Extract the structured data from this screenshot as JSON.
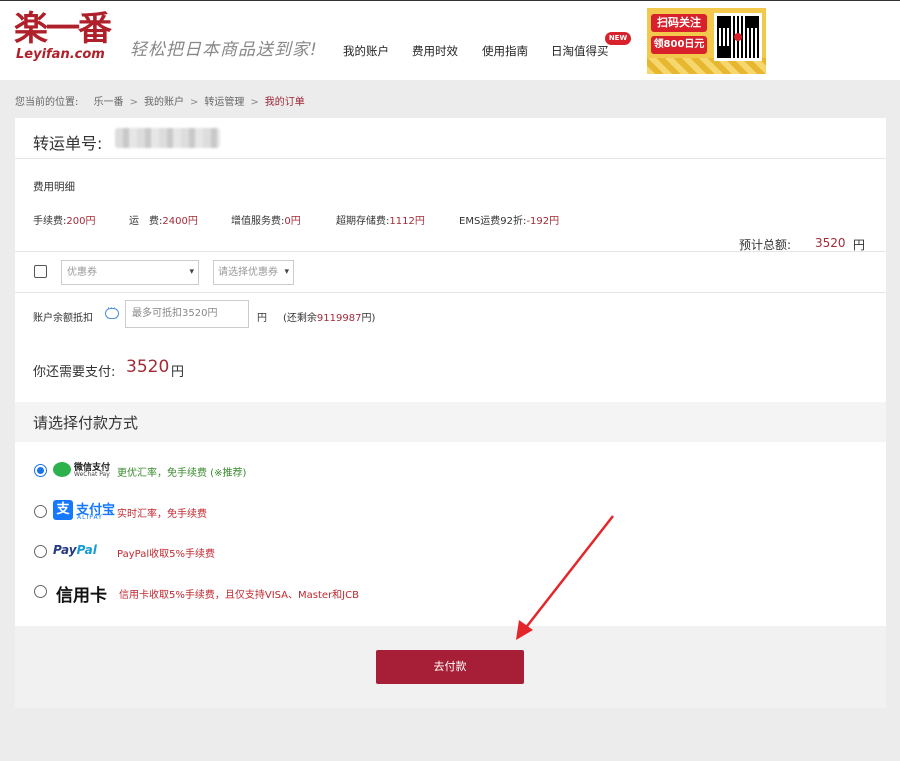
{
  "header": {
    "logo_cn": "楽一番",
    "logo_en": "Leyifan.com",
    "slogan": "轻松把日本商品送到家!",
    "nav": [
      "我的账户",
      "费用时效",
      "使用指南",
      "日淘值得买"
    ],
    "new_badge": "NEW",
    "promo_line1": "扫码关注",
    "promo_line2": "领800日元"
  },
  "breadcrumb": {
    "prefix": "您当前的位置:",
    "items": [
      "乐一番",
      "我的账户",
      "转运管理"
    ],
    "current": "我的订单"
  },
  "order": {
    "title": "转运单号:"
  },
  "fees": {
    "title": "费用明细",
    "items": [
      {
        "label": "手续费:",
        "value": "200",
        "unit": "円"
      },
      {
        "label": "运　费:",
        "value": "2400",
        "unit": "円"
      },
      {
        "label": "增值服务费:",
        "value": "0",
        "unit": "円"
      },
      {
        "label": "超期存储费:",
        "value": "1112",
        "unit": "円"
      },
      {
        "label": "EMS运费92折:",
        "value": "-192",
        "unit": "円"
      }
    ],
    "total_label": "预计总额:",
    "total_value": "3520",
    "total_unit": "円"
  },
  "coupon": {
    "select1_placeholder": "优惠券",
    "select2_placeholder": "请选择优惠券"
  },
  "balance": {
    "label": "账户余额抵扣",
    "input_placeholder": "最多可抵扣3520円",
    "unit": "円",
    "remain_prefix": "(还剩余",
    "remain_value": "9119987",
    "remain_suffix": "円)"
  },
  "payable": {
    "label": "你还需要支付:",
    "amount": "3520",
    "unit": "円"
  },
  "methods": {
    "title": "请选择付款方式",
    "wechat": {
      "name_cn": "微信支付",
      "name_en": "WeChat Pay",
      "note": "更优汇率，免手续费 (※推荐)"
    },
    "alipay": {
      "mark": "支",
      "name_cn": "支付宝",
      "name_en": "ALIPAY",
      "note": "实时汇率，免手续费"
    },
    "paypal": {
      "name_a": "Pay",
      "name_b": "Pal",
      "note": "PayPal收取5%手续费"
    },
    "credit": {
      "name": "信用卡",
      "note": "信用卡收取5%手续费，且仅支持VISA、Master和JCB"
    }
  },
  "submit": {
    "label": "去付款"
  },
  "colors": {
    "brand_red": "#a61f36",
    "price_red": "#a32b38",
    "wechat_green": "#2db14a",
    "alipay_blue": "#1677ff"
  }
}
